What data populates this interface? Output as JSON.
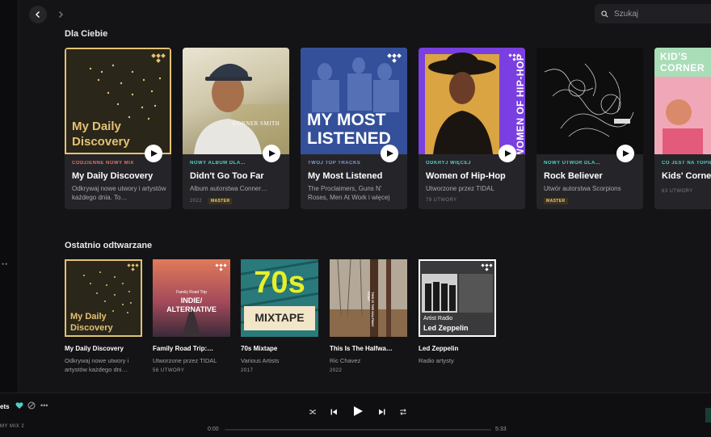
{
  "search": {
    "placeholder": "Szukaj"
  },
  "sections": {
    "for_you": "Dla Ciebie",
    "recent": "Ostatnio odtwarzane"
  },
  "featured": [
    {
      "art_text": "My Daily Discovery",
      "eyebrow": "CODZIENNE NOWY MIX",
      "eyebrow_color": "#e0745f",
      "title": "My Daily Discovery",
      "subtitle": "Odkrywaj nowe utwory i artystów każdego dnia. To…",
      "info": "",
      "badge": ""
    },
    {
      "art_text": "CONNER SMITH",
      "eyebrow": "NOWY ALBUM DLA…",
      "eyebrow_color": "#4fd1c5",
      "title": "Didn't Go Too Far",
      "subtitle": "Album autorstwa Conner…",
      "info": "2022",
      "badge": "MASTER"
    },
    {
      "art_text": "MY MOST LISTENED",
      "eyebrow": "TWÓJ TOP TRACKS",
      "eyebrow_color": "#7a9fe0",
      "title": "My Most Listened",
      "subtitle": "The Proclaimers, Guns N' Roses, Men At Work i więcej",
      "info": "",
      "badge": ""
    },
    {
      "art_text": "WOMEN OF HIP-HOP",
      "eyebrow": "ODKRYJ WIĘCEJ",
      "eyebrow_color": "#4fd1c5",
      "title": "Women of Hip-Hop",
      "subtitle": "Utworzone przez TIDAL",
      "info": "79 UTWORY",
      "badge": ""
    },
    {
      "art_text": "",
      "eyebrow": "NOWY UTWÓR DLA…",
      "eyebrow_color": "#4fd1c5",
      "title": "Rock Believer",
      "subtitle": "Utwór autorstwa Scorpions",
      "info": "",
      "badge": "MASTER"
    },
    {
      "art_text": "KID'S CORNER",
      "eyebrow": "CO JEST NA TOPIE",
      "eyebrow_color": "#4fd1c5",
      "title": "Kids' Corner",
      "subtitle": "",
      "info": "63 UTWORY",
      "badge": ""
    }
  ],
  "recent": [
    {
      "art_line1": "My Daily",
      "art_line2": "Discovery",
      "title": "My Daily Discovery",
      "subtitle": "Odkrywaj nowe utwory i artystów każdego dni…"
    },
    {
      "art_top": "Family Road Trip",
      "art_line1": "INDIE/",
      "art_line2": "ALTERNATIVE",
      "title": "Family Road Trip:…",
      "subtitle": "Utworzone przez TIDAL",
      "info": "56 UTWORY"
    },
    {
      "art_line1": "70s",
      "art_line2": "MIXTAPE",
      "title": "70s Mixtape",
      "subtitle": "Various Artists",
      "info": "2017"
    },
    {
      "art_side": "THIS IS THE HALFWAY POINT",
      "title": "This Is The Halfwa…",
      "subtitle": "Ric Chavez",
      "info": "2022"
    },
    {
      "art_top": "Artist Radio",
      "art_line1": "Led Zeppelin",
      "title": "Led Zeppelin",
      "subtitle": "Radio artysty"
    }
  ],
  "player": {
    "track": "ets",
    "source": "MY MIX 2",
    "elapsed": "0:00",
    "total": "5:33",
    "progress": 0
  },
  "colors": {
    "accent": "#4fd1c5",
    "discovery_gold": "#e4c174",
    "most_listened_blue": "#3d5aa8",
    "hiphop_purple": "#7a3fe0"
  }
}
